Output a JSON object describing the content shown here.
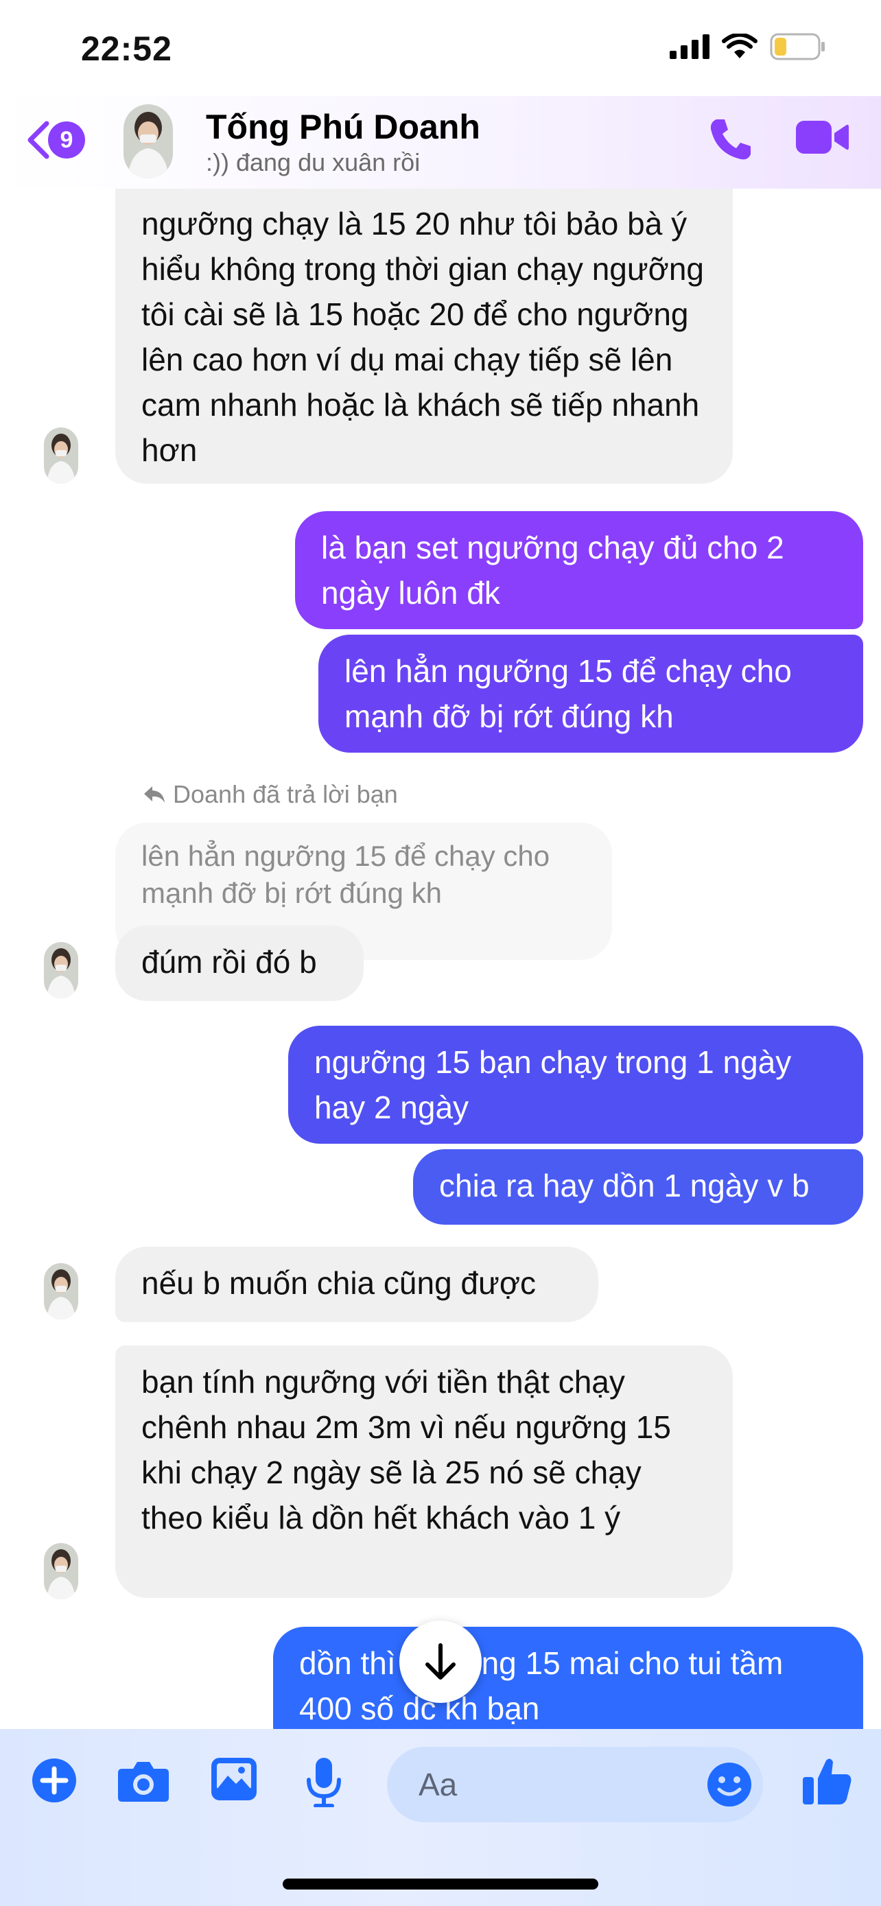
{
  "status_bar": {
    "time": "22:52",
    "battery_level": 0.25
  },
  "header": {
    "back_count": "9",
    "contact_name": "Tống Phú Doanh",
    "contact_status": ":)) đang du xuân rồi",
    "accent_color": "#8a3ffc"
  },
  "messages": [
    {
      "side": "in",
      "text": "ngưỡng chạy là 15 20 như tôi bảo bà ý hiểu không trong thời gian chạy ngưỡng tôi cài sẽ là 15 hoặc 20 để cho ngưỡng lên cao hơn ví dụ mai chạy tiếp sẽ lên cam nhanh hoặc là khách sẽ tiếp nhanh hơn"
    },
    {
      "side": "out",
      "text": "là bạn set ngưỡng chạy đủ cho 2 ngày luôn đk"
    },
    {
      "side": "out",
      "text": "lên hẳn ngưỡng 15 để chạy cho mạnh đỡ bị rớt đúng kh"
    },
    {
      "side": "in",
      "reply_label": "Doanh đã trả lời bạn",
      "quoted": "lên hẳn ngưỡng 15 để chạy cho mạnh đỡ bị rớt đúng kh",
      "text": "đúm rồi đó b"
    },
    {
      "side": "out",
      "text": "ngưỡng 15 bạn chạy trong 1 ngày hay 2 ngày"
    },
    {
      "side": "out",
      "text": "chia ra hay dồn 1 ngày v b"
    },
    {
      "side": "in",
      "text": "nếu b muốn chia cũng được"
    },
    {
      "side": "in",
      "text": "bạn tính ngưỡng với tiền thật chạy chênh nhau 2m 3m vì nếu ngưỡng 15 khi chạy 2 ngày sẽ là 25 nó sẽ chạy theo kiểu là dồn hết khách vào 1 ý"
    },
    {
      "side": "out",
      "text": "dồn thì ngưỡng 15 mai cho tui tầm 400 số dc kh bạn"
    }
  ],
  "composer": {
    "placeholder": "Aa"
  },
  "colors": {
    "incoming_bg": "#f0f0f0",
    "outgoing_top": "#8a3ffc",
    "outgoing_bottom": "#2f6bff"
  }
}
